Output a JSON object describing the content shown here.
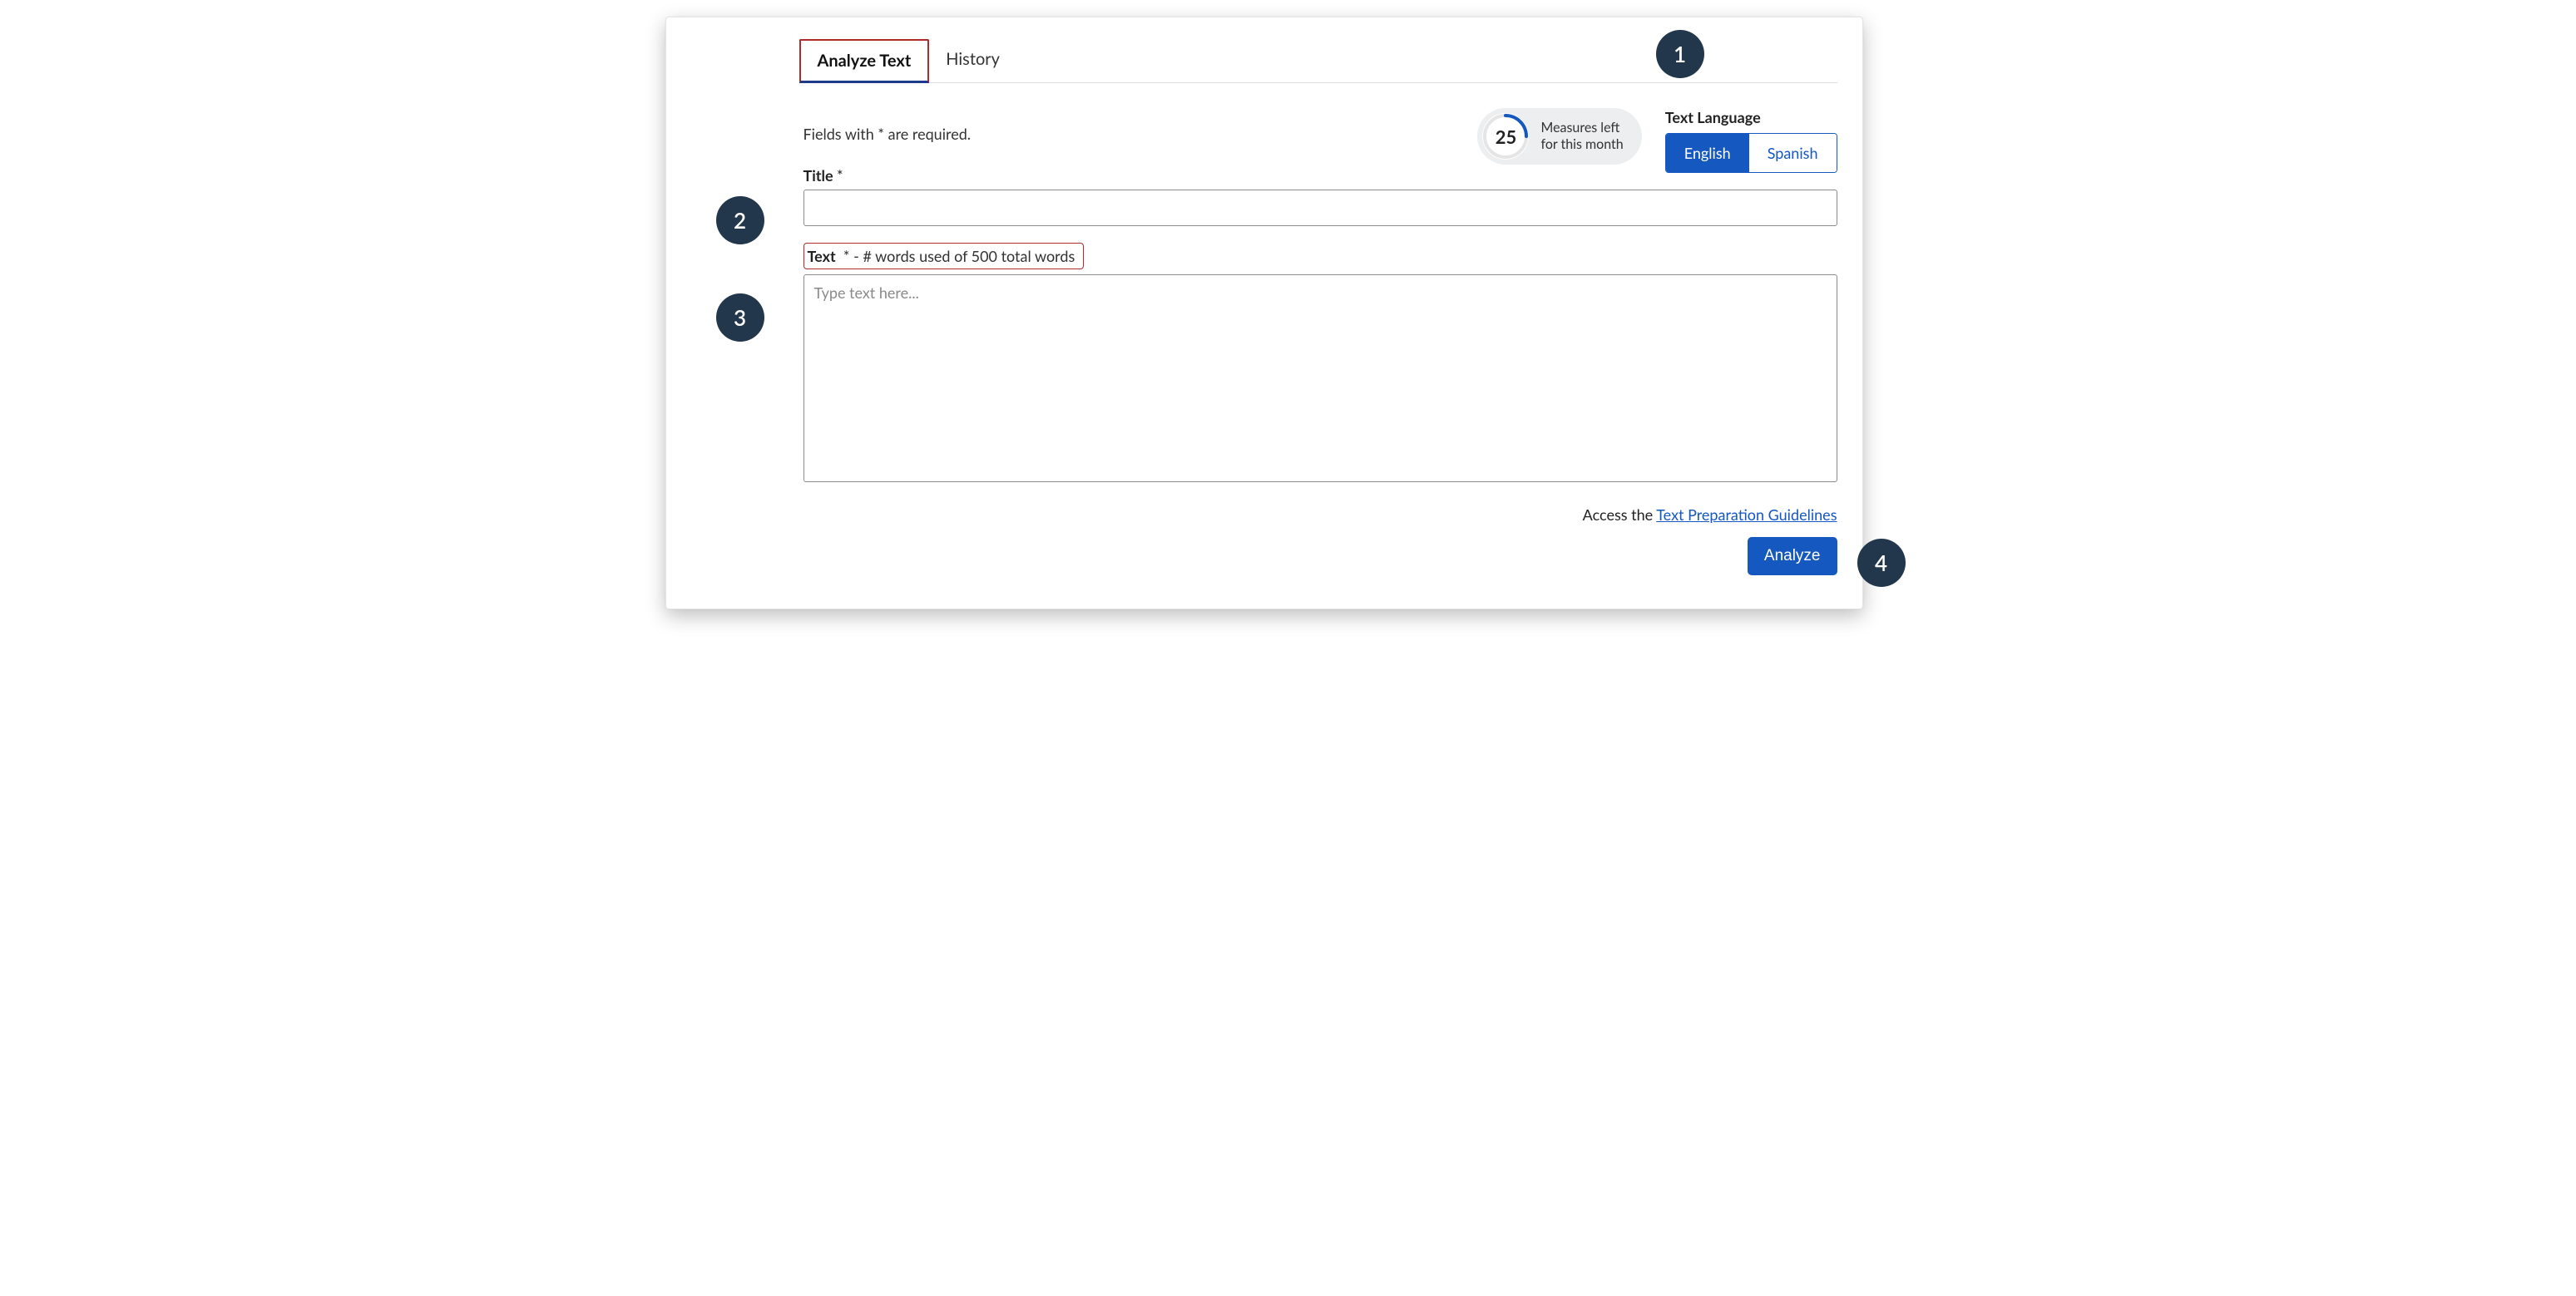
{
  "tabs": {
    "analyze": "Analyze Text",
    "history": "History"
  },
  "measures": {
    "count": "25",
    "label_line1": "Measures left",
    "label_line2": "for this month"
  },
  "language": {
    "title": "Text Language",
    "english": "English",
    "spanish": "Spanish"
  },
  "required_note": "Fields with * are required.",
  "title_field": {
    "label": "Title",
    "star": "*"
  },
  "text_field": {
    "label": "Text",
    "star": "*",
    "counter": " -  # words used of 500 total words",
    "placeholder": "Type text here..."
  },
  "guidelines": {
    "prefix": "Access the ",
    "link": "Text Preparation Guidelines"
  },
  "analyze_button": "Analyze",
  "badges": {
    "b1": "1",
    "b2": "2",
    "b3": "3",
    "b4": "4"
  }
}
